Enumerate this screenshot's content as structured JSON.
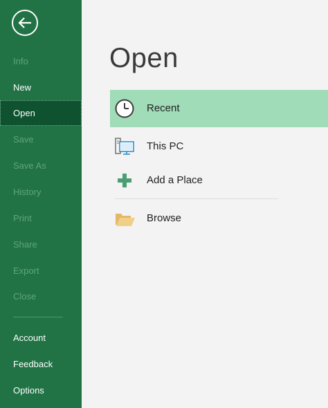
{
  "sidebar": {
    "items": [
      {
        "label": "Info",
        "state": "disabled"
      },
      {
        "label": "New",
        "state": "enabled"
      },
      {
        "label": "Open",
        "state": "selected"
      },
      {
        "label": "Save",
        "state": "disabled"
      },
      {
        "label": "Save As",
        "state": "disabled"
      },
      {
        "label": "History",
        "state": "disabled"
      },
      {
        "label": "Print",
        "state": "disabled"
      },
      {
        "label": "Share",
        "state": "disabled"
      },
      {
        "label": "Export",
        "state": "disabled"
      },
      {
        "label": "Close",
        "state": "disabled"
      }
    ],
    "bottom_items": [
      {
        "label": "Account"
      },
      {
        "label": "Feedback"
      },
      {
        "label": "Options"
      }
    ],
    "back_icon": "back-arrow-icon"
  },
  "main": {
    "title": "Open",
    "locations": [
      {
        "label": "Recent",
        "icon": "clock-icon",
        "selected": true
      },
      {
        "label": "This PC",
        "icon": "computer-icon",
        "selected": false
      },
      {
        "label": "Add a Place",
        "icon": "plus-icon",
        "selected": false
      },
      {
        "label": "Browse",
        "icon": "folder-icon",
        "selected": false
      }
    ]
  },
  "colors": {
    "sidebar_bg": "#217346",
    "sidebar_selected": "#0f5230",
    "location_selected": "#9fdcb7",
    "background": "#f3f3f3"
  }
}
